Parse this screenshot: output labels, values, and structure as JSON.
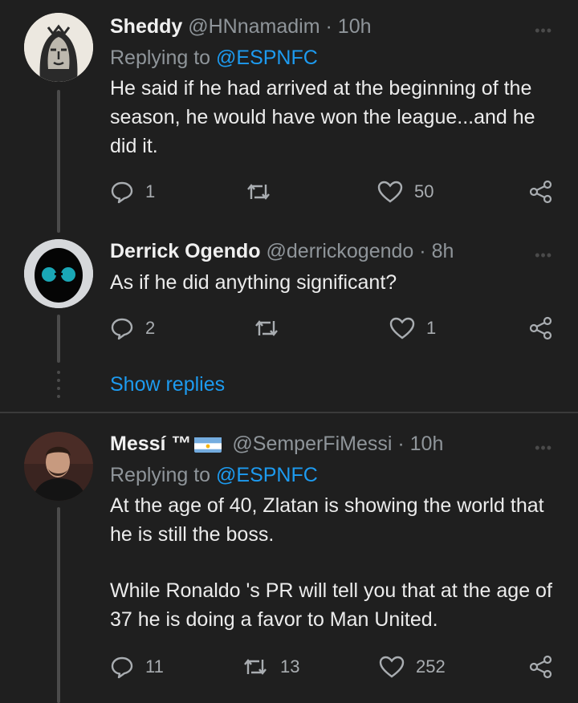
{
  "tweets": [
    {
      "name": "Sheddy",
      "handle": "@HNnamadim",
      "time": "· 10h",
      "replying_prefix": "Replying to",
      "replying_to": "@ESPNFC",
      "text": "He said if he had arrived at the beginning of the season, he would have won the league...and he did it.",
      "replies": "1",
      "retweets": "",
      "likes": "50",
      "avatar": "face-sketch-avatar"
    },
    {
      "name": "Derrick Ogendo",
      "handle": "@derrickogendo",
      "time": "· 8h",
      "text": "As if he did anything significant?",
      "replies": "2",
      "retweets": "",
      "likes": "1",
      "avatar": "sunglasses-avatar"
    },
    {
      "name": "Messí ™",
      "handle": "@SemperFiMessi",
      "time": "· 10h",
      "replying_prefix": "Replying to",
      "replying_to": "@ESPNFC",
      "text1": "At the age of 40, Zlatan is showing the world that he is still the boss.",
      "text2": "While Ronaldo 's PR will tell you that at the age of 37 he is doing a favor to Man United.",
      "replies": "11",
      "retweets": "13",
      "likes": "252",
      "avatar": "player-photo-avatar",
      "flag": "argentina-flag-icon"
    }
  ],
  "show_replies": "Show replies",
  "colors": {
    "background": "#1f1f1f",
    "link": "#1d9bf0",
    "muted": "#8f959a"
  },
  "icons": [
    "reply-icon",
    "retweet-icon",
    "like-icon",
    "share-icon",
    "more-icon"
  ]
}
